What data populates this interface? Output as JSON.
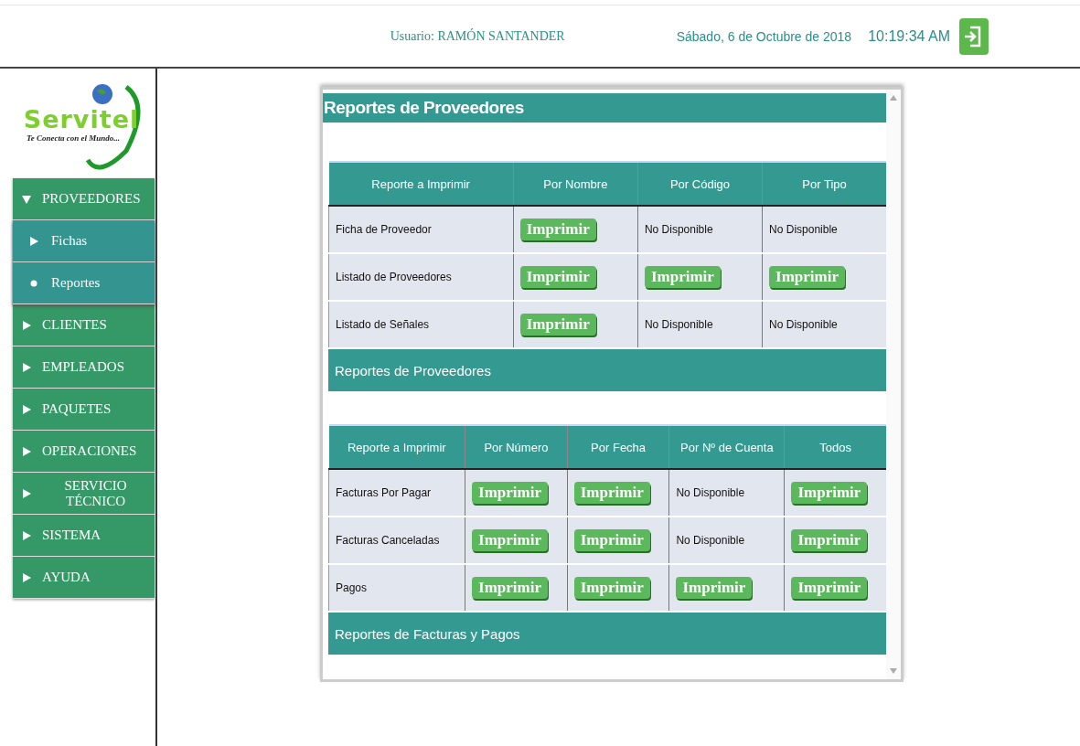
{
  "header": {
    "user": "Usuario: RAMÓN SANTANDER",
    "date": "Sábado, 6 de Octubre de 2018",
    "time": "10:19:34 AM"
  },
  "logo": {
    "name": "Servitel",
    "tagline": "Te Conecta con el Mundo..."
  },
  "sidebar": {
    "items": [
      {
        "label": "PROVEEDORES",
        "expanded": true,
        "children": [
          {
            "label": "Fichas",
            "selected": false
          },
          {
            "label": "Reportes",
            "selected": true
          }
        ]
      },
      {
        "label": "CLIENTES",
        "expanded": false
      },
      {
        "label": "EMPLEADOS",
        "expanded": false
      },
      {
        "label": "PAQUETES",
        "expanded": false
      },
      {
        "label": "OPERACIONES",
        "expanded": false
      },
      {
        "label": "SERVICIO TÉCNICO",
        "expanded": false
      },
      {
        "label": "SISTEMA",
        "expanded": false
      },
      {
        "label": "AYUDA",
        "expanded": false
      }
    ]
  },
  "panel": {
    "title": "Reportes de Proveedores",
    "tables": [
      {
        "columns": [
          "Reporte a Imprimir",
          "Por Nombre",
          "Por Código",
          "Por Tipo"
        ],
        "rows": [
          [
            {
              "kind": "text",
              "text": "Ficha de Proveedor"
            },
            {
              "kind": "button",
              "text": "Imprimir"
            },
            {
              "kind": "text",
              "text": "No Disponible"
            },
            {
              "kind": "text",
              "text": "No Disponible"
            }
          ],
          [
            {
              "kind": "text",
              "text": "Listado de Proveedores"
            },
            {
              "kind": "button",
              "text": "Imprimir"
            },
            {
              "kind": "button",
              "text": "Imprimir"
            },
            {
              "kind": "button",
              "text": "Imprimir"
            }
          ],
          [
            {
              "kind": "text",
              "text": "Listado de Señales"
            },
            {
              "kind": "button",
              "text": "Imprimir"
            },
            {
              "kind": "text",
              "text": "No Disponible"
            },
            {
              "kind": "text",
              "text": "No Disponible"
            }
          ]
        ],
        "footer": "Reportes de Proveedores"
      },
      {
        "columns": [
          "Reporte a Imprimir",
          "Por Número",
          "Por Fecha",
          "Por Nº de Cuenta",
          "Todos"
        ],
        "rows": [
          [
            {
              "kind": "text",
              "text": "Facturas Por Pagar"
            },
            {
              "kind": "button",
              "text": "Imprimir"
            },
            {
              "kind": "button",
              "text": "Imprimir"
            },
            {
              "kind": "text",
              "text": "No Disponible"
            },
            {
              "kind": "button",
              "text": "Imprimir"
            }
          ],
          [
            {
              "kind": "text",
              "text": "Facturas Canceladas"
            },
            {
              "kind": "button",
              "text": "Imprimir"
            },
            {
              "kind": "button",
              "text": "Imprimir"
            },
            {
              "kind": "text",
              "text": "No Disponible"
            },
            {
              "kind": "button",
              "text": "Imprimir"
            }
          ],
          [
            {
              "kind": "text",
              "text": "Pagos"
            },
            {
              "kind": "button",
              "text": "Imprimir"
            },
            {
              "kind": "button",
              "text": "Imprimir"
            },
            {
              "kind": "button",
              "text": "Imprimir"
            },
            {
              "kind": "button",
              "text": "Imprimir"
            }
          ]
        ],
        "footer": "Reportes de Facturas y Pagos"
      }
    ]
  }
}
